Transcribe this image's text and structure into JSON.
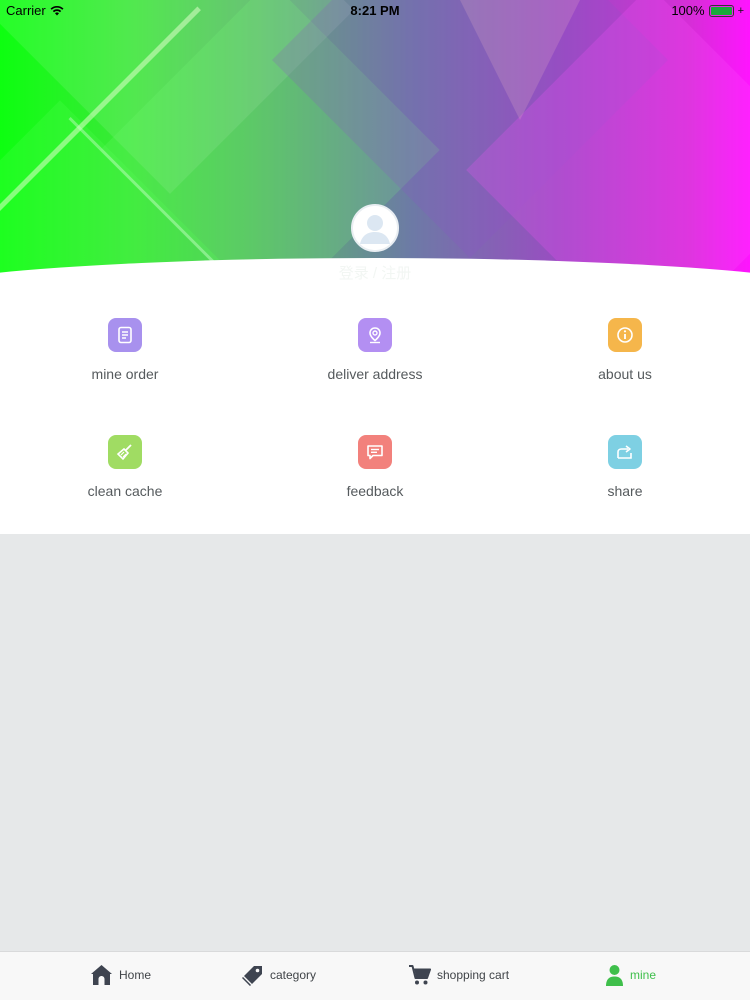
{
  "status_bar": {
    "carrier": "Carrier",
    "time": "8:21 PM",
    "battery": "100%",
    "wifi_icon": "wifi-icon",
    "battery_icon": "battery-icon"
  },
  "profile": {
    "avatar_icon": "user-avatar-icon",
    "login_text": "登录 / 注册"
  },
  "menu": {
    "items": [
      {
        "label": "mine order",
        "icon": "order-list-icon",
        "color": "#a891ee"
      },
      {
        "label": "deliver address",
        "icon": "location-pin-icon",
        "color": "#b38ff2"
      },
      {
        "label": "about us",
        "icon": "info-icon",
        "color": "#f5b64b"
      },
      {
        "label": "clean cache",
        "icon": "broom-icon",
        "color": "#a0dc63"
      },
      {
        "label": "feedback",
        "icon": "message-icon",
        "color": "#f2817c"
      },
      {
        "label": "share",
        "icon": "share-icon",
        "color": "#7ed0e3"
      }
    ]
  },
  "tabbar": {
    "active_color": "#3fbf4b",
    "items": [
      {
        "label": "Home",
        "icon": "home-icon"
      },
      {
        "label": "category",
        "icon": "tag-icon"
      },
      {
        "label": "shopping cart",
        "icon": "cart-icon"
      },
      {
        "label": "mine",
        "icon": "person-icon",
        "active": true
      }
    ]
  }
}
